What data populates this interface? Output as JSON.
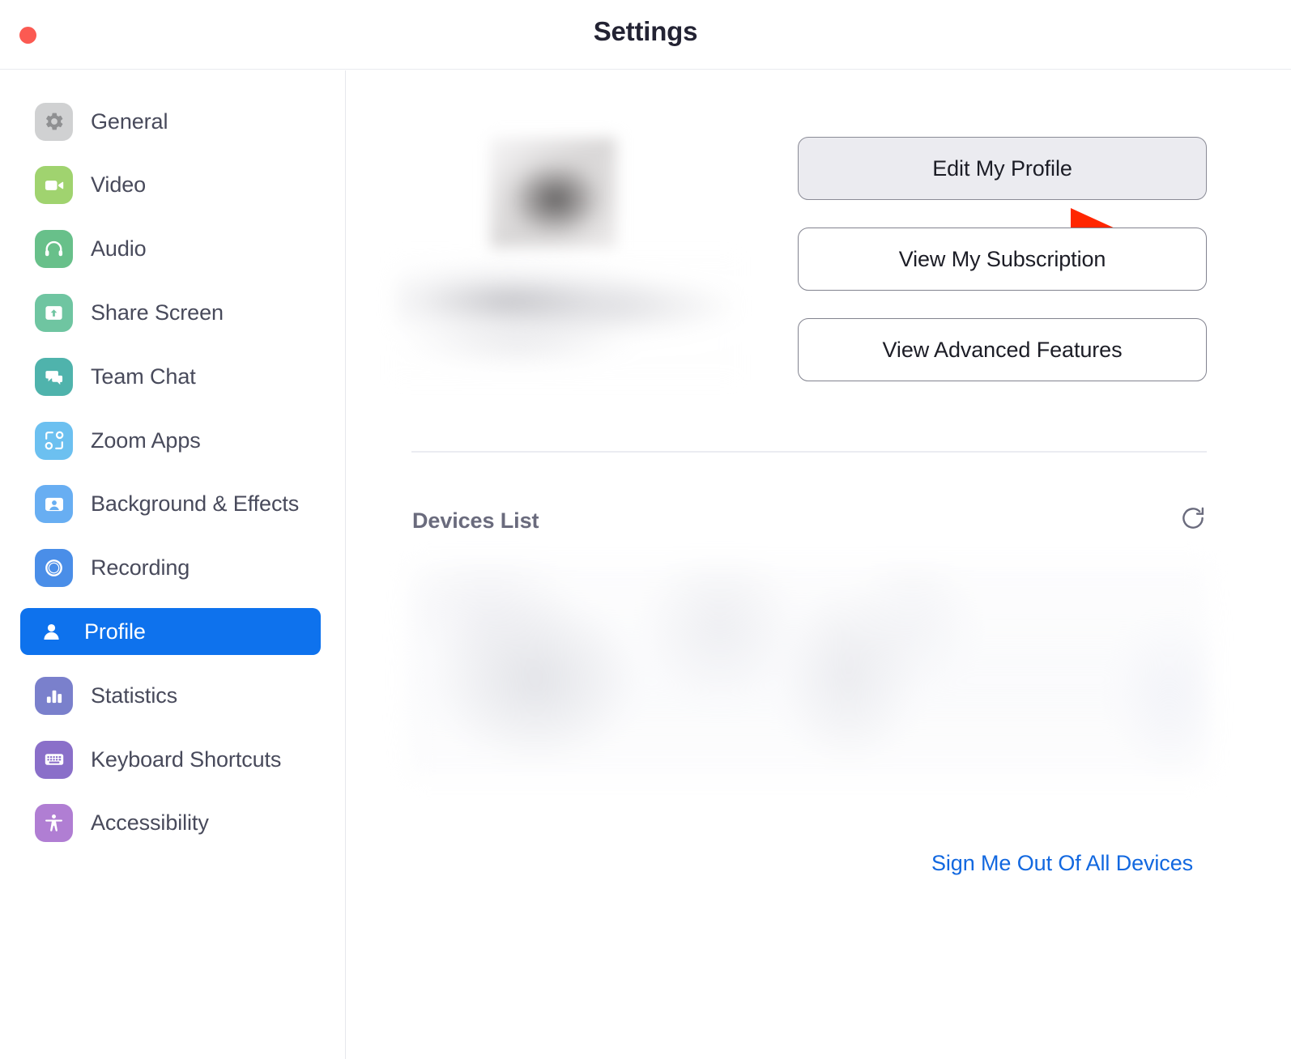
{
  "window": {
    "title": "Settings",
    "close_button": "close-traffic-light",
    "close_color": "#fb5a52"
  },
  "sidebar": {
    "items": [
      {
        "label": "General",
        "icon": "gear-icon",
        "icon_bg": "#d0d1d2",
        "active": false
      },
      {
        "label": "Video",
        "icon": "video-camera-icon",
        "icon_bg": "#a0d36f",
        "active": false
      },
      {
        "label": "Audio",
        "icon": "headphones-icon",
        "icon_bg": "#68c08a",
        "active": false
      },
      {
        "label": "Share Screen",
        "icon": "share-screen-icon",
        "icon_bg": "#6fc5a1",
        "active": false
      },
      {
        "label": "Team Chat",
        "icon": "chat-bubbles-icon",
        "icon_bg": "#4fb3ac",
        "active": false
      },
      {
        "label": "Zoom Apps",
        "icon": "zoom-apps-icon",
        "icon_bg": "#6cc0f0",
        "active": false
      },
      {
        "label": "Background & Effects",
        "icon": "person-frame-icon",
        "icon_bg": "#68aef2",
        "active": false
      },
      {
        "label": "Recording",
        "icon": "record-circle-icon",
        "icon_bg": "#4a8ee8",
        "active": false
      },
      {
        "label": "Profile",
        "icon": "person-icon",
        "icon_bg": "#0e72ed",
        "active": true
      },
      {
        "label": "Statistics",
        "icon": "bar-chart-icon",
        "icon_bg": "#7a80cc",
        "active": false
      },
      {
        "label": "Keyboard Shortcuts",
        "icon": "keyboard-icon",
        "icon_bg": "#8a6fc9",
        "active": false
      },
      {
        "label": "Accessibility",
        "icon": "accessibility-icon",
        "icon_bg": "#b07ed3",
        "active": false
      }
    ],
    "active_color": "#0e72ed"
  },
  "main": {
    "profile": {
      "avatar": "blurred-profile-avatar",
      "name": "blurred-account-name"
    },
    "annotation": {
      "type": "red-arrow",
      "color": "#ff2600",
      "points_to": "Edit My Profile"
    },
    "buttons": {
      "edit_profile": "Edit My Profile",
      "view_subscription": "View My Subscription",
      "view_advanced": "View Advanced Features"
    },
    "devices": {
      "title": "Devices List",
      "refresh_icon": "refresh-icon",
      "list": "blurred-device-entries",
      "signout_link": "Sign Me Out Of All Devices",
      "link_color": "#1268e0"
    }
  }
}
